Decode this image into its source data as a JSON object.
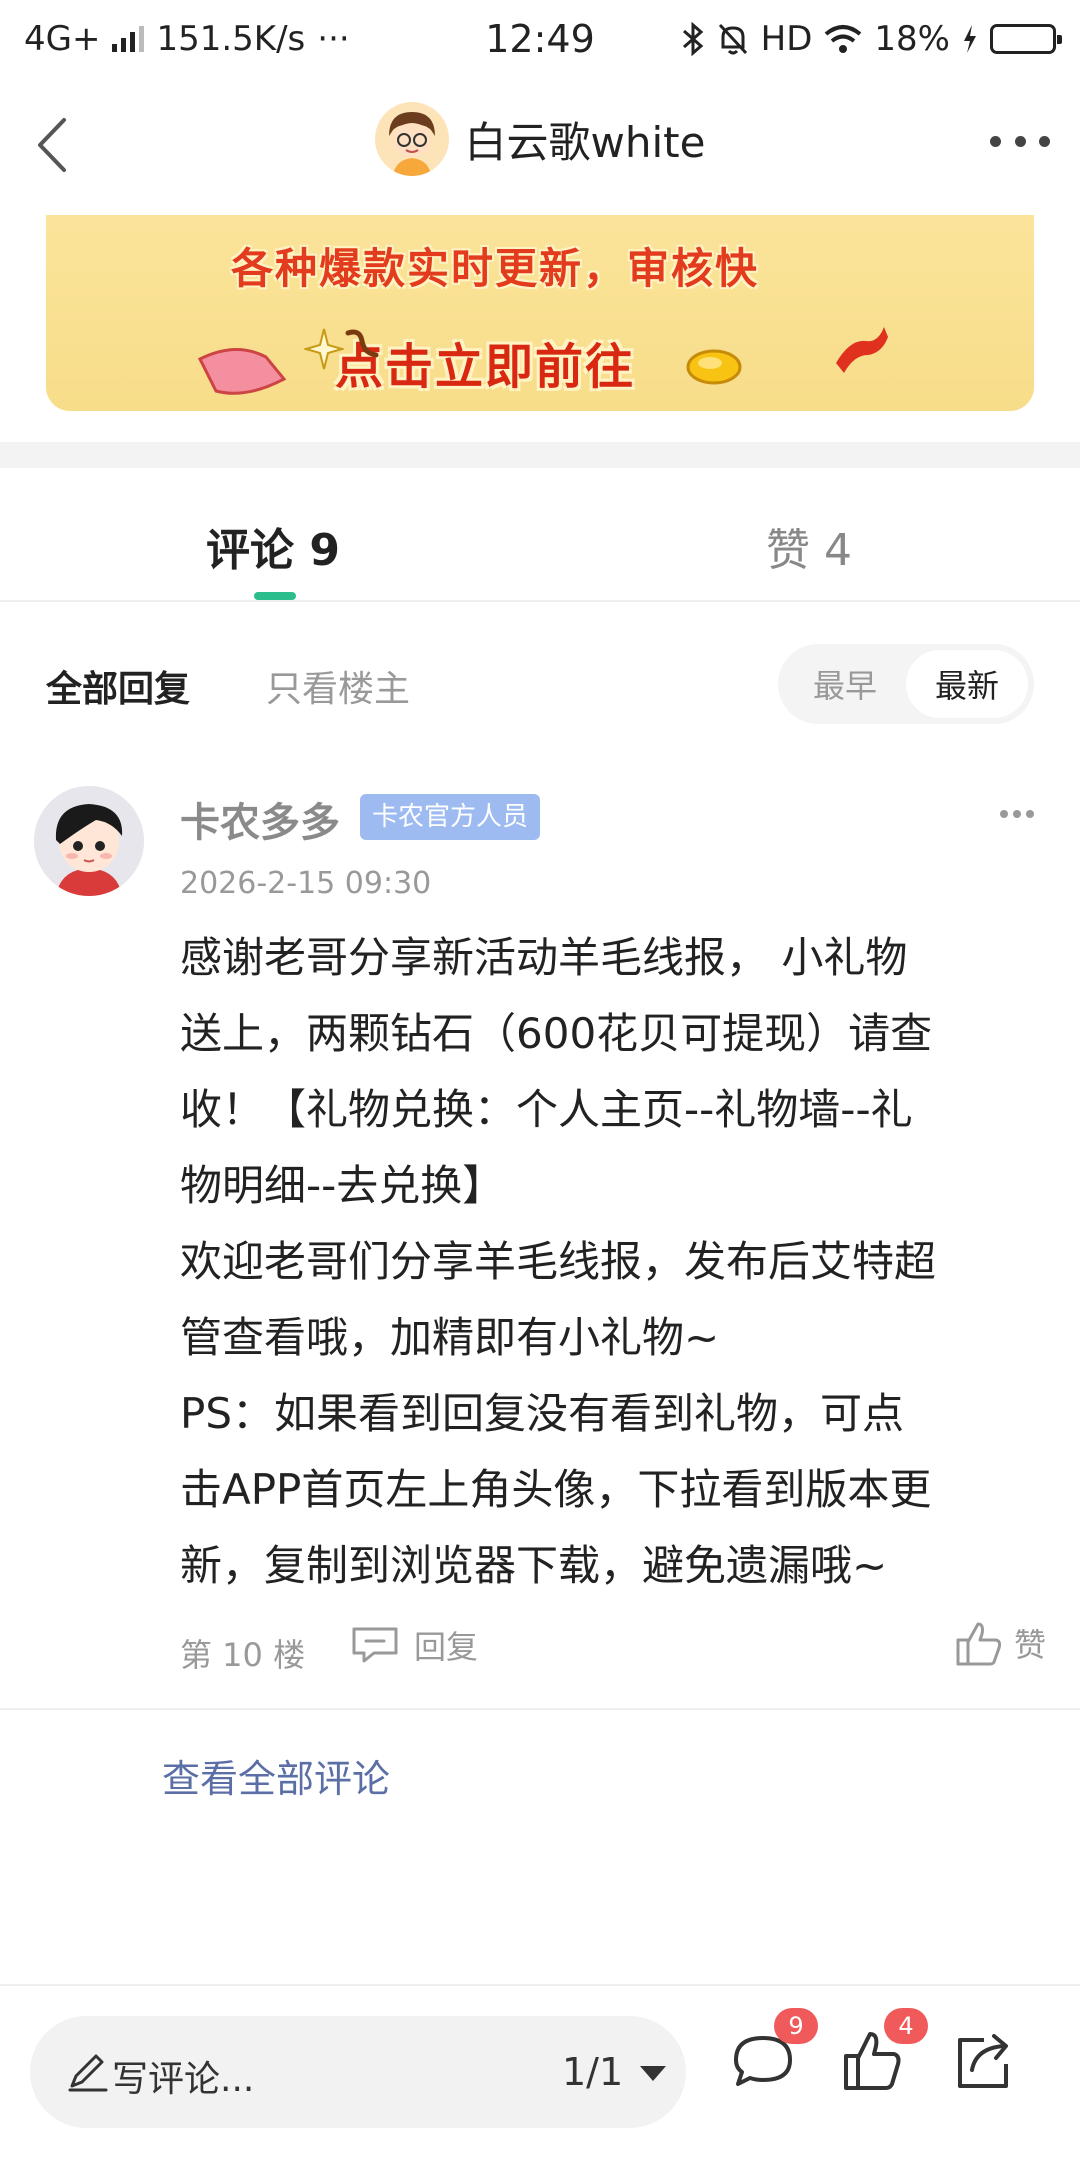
{
  "status_bar": {
    "network": "4G+",
    "speed": "151.5K/s",
    "more": "···",
    "time": "12:49",
    "hd": "HD",
    "battery": "18%",
    "battery_level": 0.18
  },
  "header": {
    "author_name": "白云歌white"
  },
  "banner": {
    "line1": "各种爆款实时更新，审核快",
    "line2": "点击立即前往"
  },
  "tabs": [
    {
      "label": "评论 9",
      "active": true
    },
    {
      "label": "赞 4",
      "active": false
    }
  ],
  "filter": {
    "all_replies": "全部回复",
    "only_op": "只看楼主",
    "sort_options": [
      {
        "label": "最早",
        "active": false
      },
      {
        "label": "最新",
        "active": true
      }
    ]
  },
  "comment": {
    "author": "卡农多多",
    "badge": "卡农官方人员",
    "time": "2026-2-15 09:30",
    "lines": [
      "感谢老哥分享新活动羊毛线报， 小礼物",
      "送上，两颗钻石（600花贝可提现）请查",
      "收！【礼物兑换：个人主页--礼物墙--礼",
      "物明细--去兑换】",
      "欢迎老哥们分享羊毛线报，发布后艾特超",
      "管查看哦，加精即有小礼物~",
      "PS：如果看到回复没有看到礼物，可点",
      "击APP首页左上角头像，下拉看到版本更",
      "新，复制到浏览器下载，避免遗漏哦~"
    ],
    "floor": "第 10 楼",
    "reply_label": "回复",
    "like_label": "赞"
  },
  "view_all": "查看全部评论",
  "bottom_bar": {
    "write_placeholder": "写评论...",
    "page_indicator": "1/1",
    "comment_count": "9",
    "like_count": "4"
  },
  "colors": {
    "accent_green": "#2bbd8c",
    "link_blue": "#5b6fa6",
    "badge_blue": "#9dbbf0",
    "count_red": "#f05a5a",
    "banner_yellow": "#fbe49a",
    "banner_text_red": "#e23b1e"
  },
  "icons": [
    "back-icon",
    "more-icon",
    "reply-icon",
    "like-icon",
    "pencil-icon",
    "comment-icon",
    "share-icon",
    "bluetooth-icon",
    "mute-icon",
    "wifi-icon",
    "charging-icon"
  ]
}
